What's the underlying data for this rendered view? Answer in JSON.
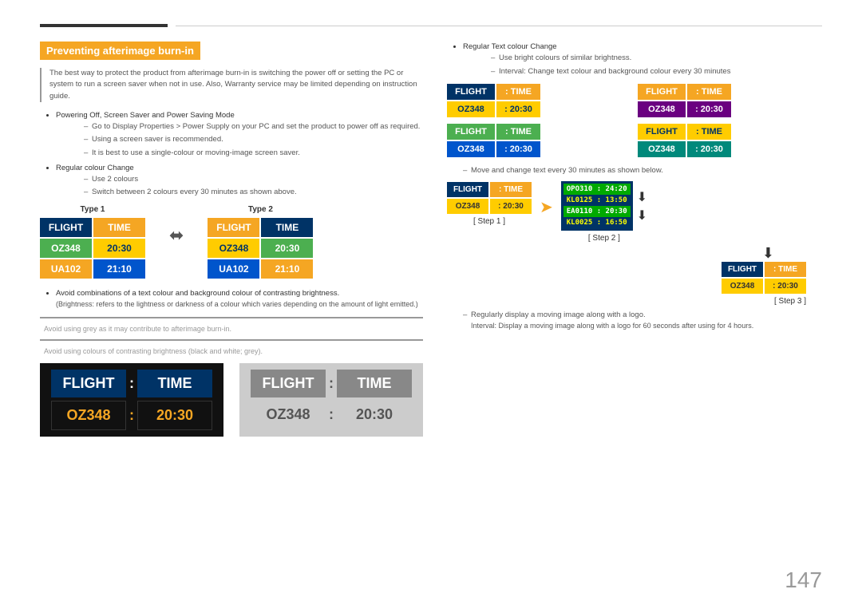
{
  "page": {
    "number": "147",
    "title": "Preventing afterimage burn-in"
  },
  "intro": {
    "text": "The best way to protect the product from afterimage burn-in is switching the power off or setting the PC or system to run a screen saver when not in use. Also, Warranty service may be limited depending on instruction guide."
  },
  "left_section": {
    "bullet1": {
      "main": "Powering Off, Screen Saver and Power Saving Mode",
      "dashes": [
        "Go to Display Properties > Power Supply on your PC and set the product to power off as required.",
        "Using a screen saver is recommended.",
        "It is best to use a single-colour or moving-image screen saver."
      ]
    },
    "bullet2": {
      "main": "Regular colour Change",
      "dashes": [
        "Use 2 colours",
        "Switch between 2 colours every 30 minutes as shown above."
      ]
    },
    "type1_label": "Type 1",
    "type2_label": "Type 2",
    "flight": "FLIGHT",
    "colon": ":",
    "time": "TIME",
    "oz348": "OZ348",
    "2030": "20:30",
    "ua102": "UA102",
    "2110": "21:10",
    "avoid1": "Avoid combinations of a text colour and background colour of contrasting brightness.",
    "avoid2": "(Brightness: refers to the lightness or darkness of a colour which varies depending on the amount of light emitted.)",
    "avoid3": "Avoid using grey as it may contribute to afterimage burn-in.",
    "avoid4": "Avoid using colours of contrasting brightness (black and white; grey)."
  },
  "right_section": {
    "bullet_main": "Regular Text colour Change",
    "dashes": [
      "Use bright colours of similar brightness.",
      "Interval: Change text colour and background colour every 30 minutes"
    ],
    "move_text": "Move and change text every 30 minutes as shown below.",
    "step1": "[ Step 1 ]",
    "step2": "[ Step 2 ]",
    "step3": "[ Step 3 ]",
    "scroll_rows": [
      "OPO310  :  24:20",
      "KL0125  :  13:50",
      "EA0110  :  20:30",
      "KL0025  :  16:50"
    ],
    "regularly_text": "Regularly display a moving image along with a logo.",
    "interval_text": "Interval: Display a moving image along with a logo for 60 seconds after using for 4 hours."
  }
}
